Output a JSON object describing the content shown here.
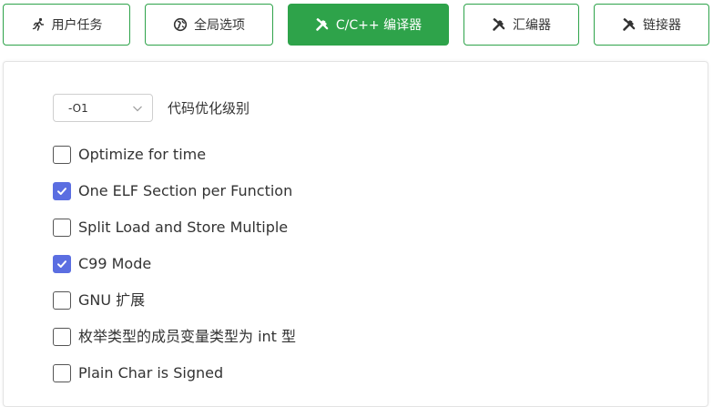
{
  "tabs": [
    {
      "label": "用户任务",
      "icon": "running-person-icon",
      "active": false
    },
    {
      "label": "全局选项",
      "icon": "globe-icon",
      "active": false
    },
    {
      "label": "C/C++ 编译器",
      "icon": "tools-icon",
      "active": true
    },
    {
      "label": "汇编器",
      "icon": "tools-icon",
      "active": false
    },
    {
      "label": "链接器",
      "icon": "tools-icon",
      "active": false
    }
  ],
  "optimization": {
    "value": "-O1",
    "label": "代码优化级别"
  },
  "options": [
    {
      "label": "Optimize for time",
      "checked": false
    },
    {
      "label": "One ELF Section per Function",
      "checked": true
    },
    {
      "label": "Split Load and Store Multiple",
      "checked": false
    },
    {
      "label": "C99 Mode",
      "checked": true
    },
    {
      "label": "GNU 扩展",
      "checked": false
    },
    {
      "label": "枚举类型的成员变量类型为 int 型",
      "checked": false
    },
    {
      "label": "Plain Char is Signed",
      "checked": false
    }
  ],
  "colors": {
    "accent_green": "#2ea34a",
    "checkbox_blue": "#5b6ee1"
  }
}
